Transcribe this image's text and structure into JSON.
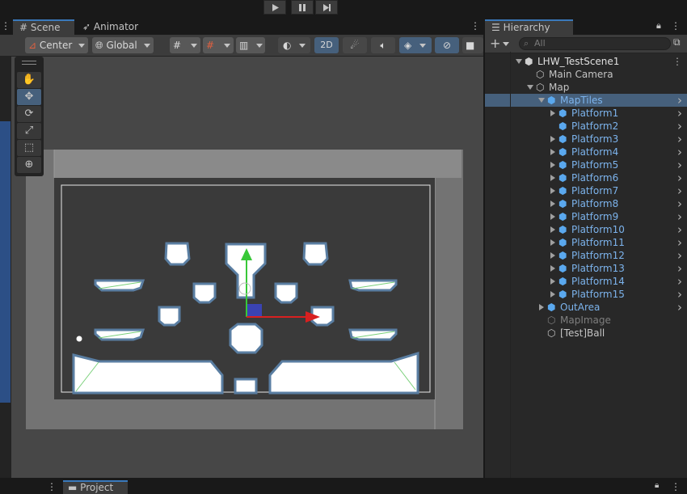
{
  "play_controls": {
    "play_icon": "play-icon",
    "pause_icon": "pause-icon",
    "step_icon": "step-icon"
  },
  "scene_tabs": [
    {
      "label": "Scene",
      "icon": "grid-icon"
    },
    {
      "label": "Animator",
      "icon": "animator-icon"
    }
  ],
  "scene_toolbar": {
    "pivot_label": "Center",
    "space_label": "Global",
    "mode_2d_label": "2D"
  },
  "tools": [
    {
      "name": "hand-tool",
      "glyph": "✋"
    },
    {
      "name": "move-tool",
      "glyph": "✥"
    },
    {
      "name": "rotate-tool",
      "glyph": "⟳"
    },
    {
      "name": "scale-tool",
      "glyph": "⤢"
    },
    {
      "name": "rect-tool",
      "glyph": "⬚"
    },
    {
      "name": "transform-tool",
      "glyph": "⊕"
    }
  ],
  "hierarchy": {
    "tab_label": "Hierarchy",
    "add_label": "+",
    "search_placeholder": "All",
    "rows": [
      {
        "label": "LHW_TestScene1",
        "type": "scene",
        "indent": 0,
        "fold": "open",
        "style": "normal",
        "chevron": false
      },
      {
        "label": "Main Camera",
        "type": "obj",
        "indent": 1,
        "fold": "none",
        "style": "normal",
        "chevron": false
      },
      {
        "label": "Map",
        "type": "obj",
        "indent": 1,
        "fold": "open",
        "style": "normal",
        "chevron": false
      },
      {
        "label": "MapTiles",
        "type": "prefab",
        "indent": 2,
        "fold": "open",
        "style": "blue",
        "chevron": true,
        "selected": true
      },
      {
        "label": "Platform1",
        "type": "prefab",
        "indent": 3,
        "fold": "closed",
        "style": "blue",
        "chevron": true
      },
      {
        "label": "Platform2",
        "type": "prefab",
        "indent": 3,
        "fold": "none",
        "style": "blue",
        "chevron": true
      },
      {
        "label": "Platform3",
        "type": "prefab",
        "indent": 3,
        "fold": "closed",
        "style": "blue",
        "chevron": true
      },
      {
        "label": "Platform4",
        "type": "prefab",
        "indent": 3,
        "fold": "closed",
        "style": "blue",
        "chevron": true
      },
      {
        "label": "Platform5",
        "type": "prefab",
        "indent": 3,
        "fold": "closed",
        "style": "blue",
        "chevron": true
      },
      {
        "label": "Platform6",
        "type": "prefab",
        "indent": 3,
        "fold": "closed",
        "style": "blue",
        "chevron": true
      },
      {
        "label": "Platform7",
        "type": "prefab",
        "indent": 3,
        "fold": "closed",
        "style": "blue",
        "chevron": true
      },
      {
        "label": "Platform8",
        "type": "prefab",
        "indent": 3,
        "fold": "closed",
        "style": "blue",
        "chevron": true
      },
      {
        "label": "Platform9",
        "type": "prefab",
        "indent": 3,
        "fold": "closed",
        "style": "blue",
        "chevron": true
      },
      {
        "label": "Platform10",
        "type": "prefab",
        "indent": 3,
        "fold": "closed",
        "style": "blue",
        "chevron": true
      },
      {
        "label": "Platform11",
        "type": "prefab",
        "indent": 3,
        "fold": "closed",
        "style": "blue",
        "chevron": true
      },
      {
        "label": "Platform12",
        "type": "prefab",
        "indent": 3,
        "fold": "closed",
        "style": "blue",
        "chevron": true
      },
      {
        "label": "Platform13",
        "type": "prefab",
        "indent": 3,
        "fold": "closed",
        "style": "blue",
        "chevron": true
      },
      {
        "label": "Platform14",
        "type": "prefab",
        "indent": 3,
        "fold": "closed",
        "style": "blue",
        "chevron": true
      },
      {
        "label": "Platform15",
        "type": "prefab",
        "indent": 3,
        "fold": "closed",
        "style": "blue",
        "chevron": true
      },
      {
        "label": "OutArea",
        "type": "prefab",
        "indent": 2,
        "fold": "closed",
        "style": "blue",
        "chevron": true
      },
      {
        "label": "MapImage",
        "type": "obj",
        "indent": 2,
        "fold": "none",
        "style": "gray",
        "chevron": false
      },
      {
        "label": "[Test]Ball",
        "type": "obj",
        "indent": 2,
        "fold": "none",
        "style": "normal",
        "chevron": false
      }
    ]
  },
  "bottom": {
    "project_label": "Project",
    "project_icon": "folder-icon"
  },
  "colors": {
    "accent": "#3a79bb",
    "selection": "#46607c",
    "prefab_text": "#7cb3ec",
    "platform_fill": "#ffffff",
    "platform_outline": "#5a7ea2",
    "gizmo_y": "#38c838",
    "gizmo_x": "#d82020"
  }
}
